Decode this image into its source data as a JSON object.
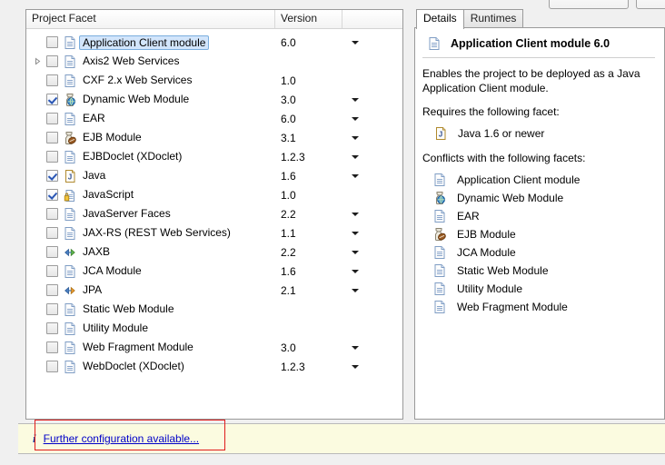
{
  "window": {
    "top_buttons": [
      "",
      ""
    ]
  },
  "tree": {
    "columns": [
      "Project Facet",
      "Version",
      ""
    ],
    "rows": [
      {
        "label": "Application Client module",
        "version": "6.0",
        "checked": false,
        "selected": true,
        "expandable": false,
        "has_dropdown": true,
        "icon": "document-icon"
      },
      {
        "label": "Axis2 Web Services",
        "version": "",
        "checked": false,
        "selected": false,
        "expandable": true,
        "has_dropdown": false,
        "icon": "document-icon"
      },
      {
        "label": "CXF 2.x Web Services",
        "version": "1.0",
        "checked": false,
        "selected": false,
        "expandable": false,
        "has_dropdown": false,
        "icon": "document-icon"
      },
      {
        "label": "Dynamic Web Module",
        "version": "3.0",
        "checked": true,
        "selected": false,
        "expandable": false,
        "has_dropdown": true,
        "icon": "web-module-icon"
      },
      {
        "label": "EAR",
        "version": "6.0",
        "checked": false,
        "selected": false,
        "expandable": false,
        "has_dropdown": true,
        "icon": "document-icon"
      },
      {
        "label": "EJB Module",
        "version": "3.1",
        "checked": false,
        "selected": false,
        "expandable": false,
        "has_dropdown": true,
        "icon": "ejb-module-icon"
      },
      {
        "label": "EJBDoclet (XDoclet)",
        "version": "1.2.3",
        "checked": false,
        "selected": false,
        "expandable": false,
        "has_dropdown": true,
        "icon": "document-icon"
      },
      {
        "label": "Java",
        "version": "1.6",
        "checked": true,
        "selected": false,
        "expandable": false,
        "has_dropdown": true,
        "icon": "java-icon"
      },
      {
        "label": "JavaScript",
        "version": "1.0",
        "checked": true,
        "selected": false,
        "expandable": false,
        "has_dropdown": false,
        "icon": "javascript-icon"
      },
      {
        "label": "JavaServer Faces",
        "version": "2.2",
        "checked": false,
        "selected": false,
        "expandable": false,
        "has_dropdown": true,
        "icon": "document-icon"
      },
      {
        "label": "JAX-RS (REST Web Services)",
        "version": "1.1",
        "checked": false,
        "selected": false,
        "expandable": false,
        "has_dropdown": true,
        "icon": "document-icon"
      },
      {
        "label": "JAXB",
        "version": "2.2",
        "checked": false,
        "selected": false,
        "expandable": false,
        "has_dropdown": true,
        "icon": "jaxb-arrows-icon"
      },
      {
        "label": "JCA Module",
        "version": "1.6",
        "checked": false,
        "selected": false,
        "expandable": false,
        "has_dropdown": true,
        "icon": "document-icon"
      },
      {
        "label": "JPA",
        "version": "2.1",
        "checked": false,
        "selected": false,
        "expandable": false,
        "has_dropdown": true,
        "icon": "jpa-arrows-icon"
      },
      {
        "label": "Static Web Module",
        "version": "",
        "checked": false,
        "selected": false,
        "expandable": false,
        "has_dropdown": false,
        "icon": "document-icon"
      },
      {
        "label": "Utility Module",
        "version": "",
        "checked": false,
        "selected": false,
        "expandable": false,
        "has_dropdown": false,
        "icon": "document-icon"
      },
      {
        "label": "Web Fragment Module",
        "version": "3.0",
        "checked": false,
        "selected": false,
        "expandable": false,
        "has_dropdown": true,
        "icon": "document-icon"
      },
      {
        "label": "WebDoclet (XDoclet)",
        "version": "1.2.3",
        "checked": false,
        "selected": false,
        "expandable": false,
        "has_dropdown": true,
        "icon": "document-icon"
      }
    ]
  },
  "details": {
    "tabs": [
      {
        "label": "Details",
        "active": true
      },
      {
        "label": "Runtimes",
        "active": false
      }
    ],
    "title": "Application Client module 6.0",
    "title_icon": "document-icon",
    "description": "Enables the project to be deployed as a Java Application Client module.",
    "requires_heading": "Requires the following facet:",
    "requires": [
      {
        "label": "Java 1.6 or newer",
        "icon": "java-icon"
      }
    ],
    "conflicts_heading": "Conflicts with the following facets:",
    "conflicts": [
      {
        "label": "Application Client module",
        "icon": "document-icon"
      },
      {
        "label": "Dynamic Web Module",
        "icon": "web-module-icon"
      },
      {
        "label": "EAR",
        "icon": "document-icon"
      },
      {
        "label": "EJB Module",
        "icon": "ejb-module-icon"
      },
      {
        "label": "JCA Module",
        "icon": "document-icon"
      },
      {
        "label": "Static Web Module",
        "icon": "document-icon"
      },
      {
        "label": "Utility Module",
        "icon": "document-icon"
      },
      {
        "label": "Web Fragment Module",
        "icon": "document-icon"
      }
    ]
  },
  "info_bar": {
    "icon": "info-icon",
    "icon_glyph": "i",
    "link_text": "Further configuration available..."
  },
  "colors": {
    "selection_bg": "#d2e5fb",
    "selection_border": "#7aaede",
    "info_bar_bg": "#fbfbe0",
    "link": "#0000c8",
    "annotation_red": "#e01b1b",
    "panel_border": "#9a9a9a"
  }
}
